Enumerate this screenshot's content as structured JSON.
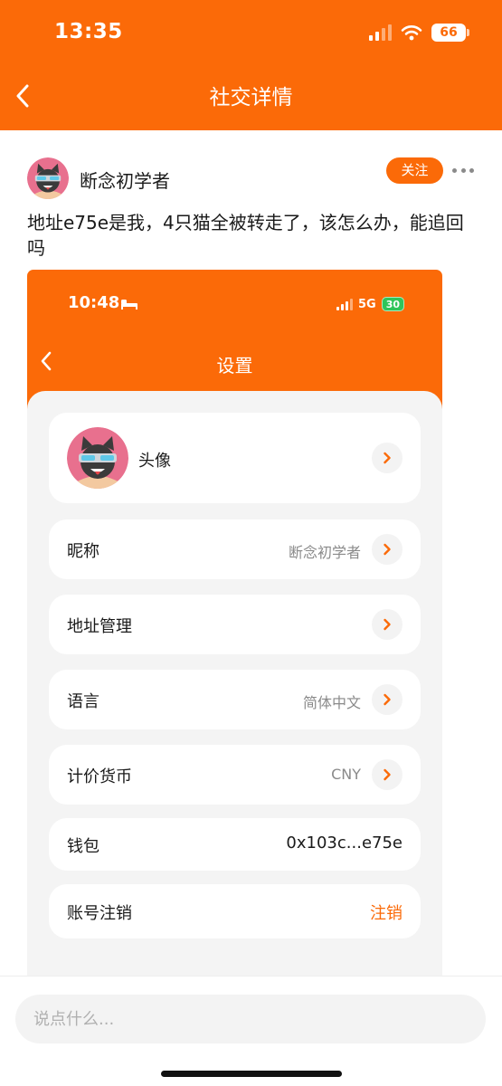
{
  "status_bar": {
    "time": "13:35",
    "battery": "66"
  },
  "nav": {
    "title": "社交详情"
  },
  "post": {
    "author": "断念初学者",
    "follow_label": "关注",
    "text": "地址e75e是我，4只猫全被转走了，该怎么办，能追回吗"
  },
  "screenshot": {
    "status_bar": {
      "time": "10:48",
      "network": "5G",
      "battery": "30"
    },
    "title": "设置",
    "rows": {
      "avatar": {
        "label": "头像"
      },
      "nickname": {
        "label": "昵称",
        "value": "断念初学者"
      },
      "address": {
        "label": "地址管理"
      },
      "language": {
        "label": "语言",
        "value": "简体中文"
      },
      "currency": {
        "label": "计价货币",
        "value": "CNY"
      },
      "wallet": {
        "label": "钱包",
        "value": "0x103c...e75e"
      },
      "account_delete": {
        "label": "账号注销",
        "action": "注销"
      }
    }
  },
  "comment": {
    "placeholder": "说点什么..."
  },
  "colors": {
    "accent": "#fb6a08",
    "page_bg": "#ffffff",
    "card_bg": "#f4f4f4"
  },
  "icons": [
    "back-icon",
    "wifi-icon",
    "signal-icon",
    "battery-icon",
    "more-icon",
    "chevron-right-icon",
    "bed-icon",
    "avatar-icon"
  ]
}
